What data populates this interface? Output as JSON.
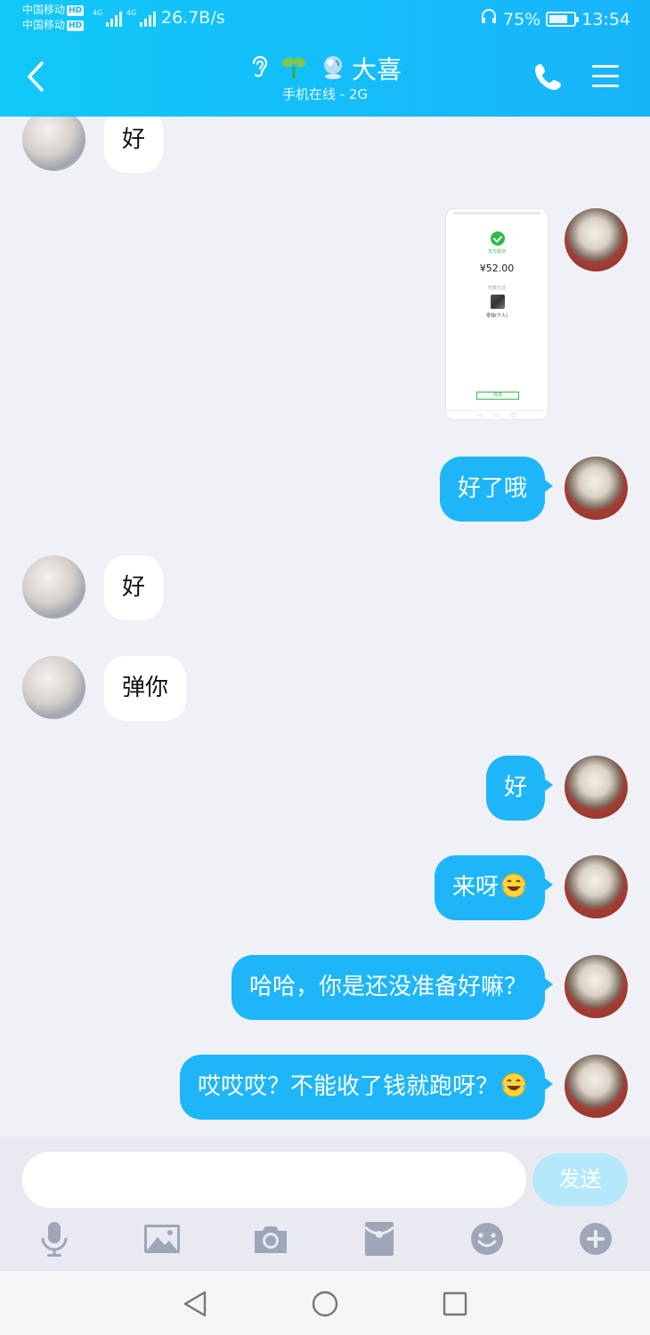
{
  "status_bar": {
    "carrier_1": "中国移动",
    "carrier_2": "中国移动",
    "hd_badge": "HD",
    "network_1": "4G",
    "network_2": "4G",
    "net_speed": "26.7B/s",
    "battery_percent": "75%",
    "battery_level": 0.75,
    "time": "13:54"
  },
  "header": {
    "contact_name": "大喜",
    "status": "手机在线 - 2G",
    "icons": [
      "ear-icon",
      "sprout-icon",
      "crystal-ball-icon",
      "back-icon",
      "phone-icon",
      "menu-icon"
    ]
  },
  "messages": [
    {
      "from": "friend",
      "type": "text",
      "text": "好"
    },
    {
      "from": "me",
      "type": "image",
      "image": {
        "pay_label": "支付成功",
        "amount": "¥52.00",
        "line1": "付款方式",
        "line2": "零钱(个人)",
        "button": "完成"
      }
    },
    {
      "from": "me",
      "type": "text",
      "text": "好了哦"
    },
    {
      "from": "friend",
      "type": "text",
      "text": "好"
    },
    {
      "from": "friend",
      "type": "text",
      "text": "弹你"
    },
    {
      "from": "me",
      "type": "text",
      "text": "好"
    },
    {
      "from": "me",
      "type": "text",
      "text": "来呀",
      "emoji": "laughing-tears-emoji"
    },
    {
      "from": "me",
      "type": "text",
      "text": "哈哈，你是还没准备好嘛？"
    },
    {
      "from": "me",
      "type": "text",
      "text": "哎哎哎？不能收了钱就跑呀？",
      "emoji": "laughing-tears-emoji"
    }
  ],
  "input": {
    "value": "",
    "send_label": "发送"
  },
  "toolbar": [
    "microphone-icon",
    "image-icon",
    "camera-icon",
    "red-packet-icon",
    "emoji-icon",
    "plus-icon"
  ],
  "colors": {
    "header_start": "#11c8f7",
    "header_end": "#18b4fa",
    "bubble_out": "#1eb6f9",
    "bubble_in": "#ffffff",
    "chat_bg": "#f0f1f7",
    "send_disabled": "#b5e8fb",
    "toolbar_icon": "#9ea6b8"
  }
}
